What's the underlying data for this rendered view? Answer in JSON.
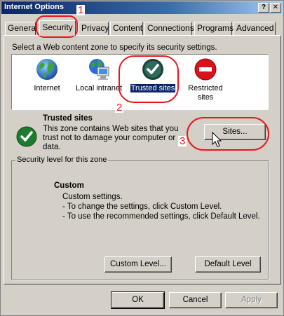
{
  "window": {
    "title": "Internet Options",
    "help_glyph": "?",
    "close_glyph": "✕"
  },
  "tabs": [
    {
      "label": "General",
      "active": false
    },
    {
      "label": "Security",
      "active": true
    },
    {
      "label": "Privacy",
      "active": false
    },
    {
      "label": "Content",
      "active": false
    },
    {
      "label": "Connections",
      "active": false
    },
    {
      "label": "Programs",
      "active": false
    },
    {
      "label": "Advanced",
      "active": false
    }
  ],
  "security": {
    "instruction": "Select a Web content zone to specify its security settings.",
    "zones": [
      {
        "label": "Internet",
        "icon": "globe-icon"
      },
      {
        "label": "Local intranet",
        "icon": "computer-globe-icon"
      },
      {
        "label": "Trusted sites",
        "icon": "checkmark-icon",
        "selected": true
      },
      {
        "label_line1": "Restricted",
        "label_line2": "sites",
        "icon": "restricted-icon"
      }
    ],
    "selected_zone": {
      "title": "Trusted sites",
      "description_line1": "This zone contains Web sites that you",
      "description_line2": "trust not to damage your computer or",
      "description_line3": "data.",
      "sites_button": "Sites..."
    },
    "level_group": {
      "title": "Security level for this zone",
      "level_name": "Custom",
      "line1": "Custom settings.",
      "line2": "- To change the settings, click Custom Level.",
      "line3": "- To use the recommended settings, click Default Level.",
      "custom_level_button": "Custom Level...",
      "default_level_button": "Default Level"
    }
  },
  "footer": {
    "ok": "OK",
    "cancel": "Cancel",
    "apply": "Apply"
  },
  "annotations": {
    "step1": "1",
    "step2": "2",
    "step3": "3",
    "color": "#e8151c"
  },
  "colors": {
    "title_bar": "#0a246a",
    "face": "#d4d0c8",
    "selection": "#0a246a",
    "check_green": "#1e7a2e",
    "restricted_red": "#d8111b"
  }
}
